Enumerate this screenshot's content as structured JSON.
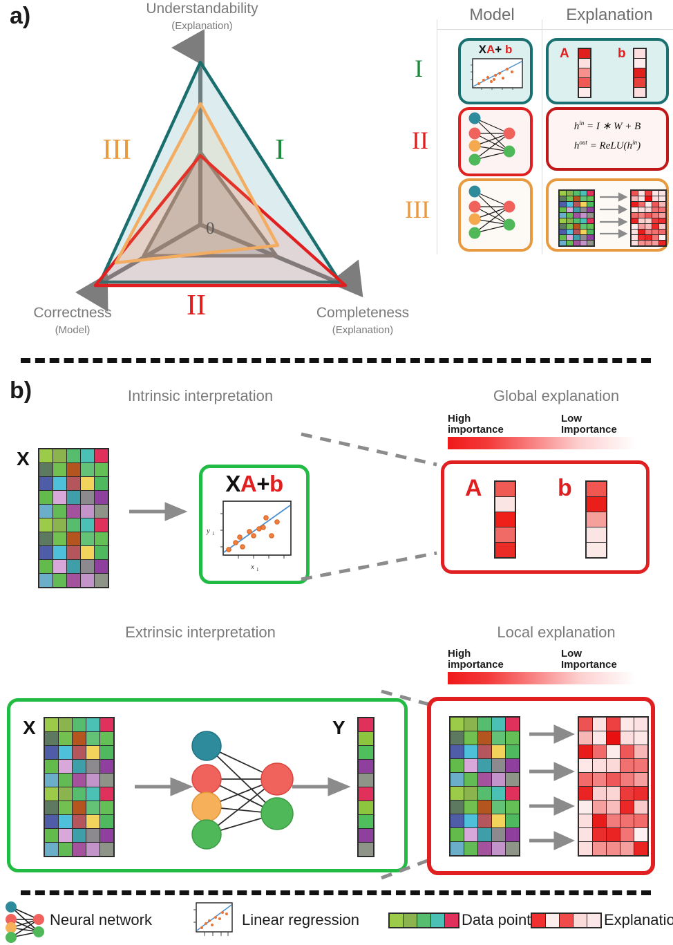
{
  "panels": {
    "a_label": "a)",
    "b_label": "b)"
  },
  "radar": {
    "axes": [
      {
        "name": "Understandability",
        "sub": "(Explanation)"
      },
      {
        "name": "Correctness",
        "sub": "(Model)"
      },
      {
        "name": "Completeness",
        "sub": "(Explanation)"
      }
    ],
    "origin_label": "0",
    "series": [
      {
        "label": "I",
        "color": "#1a6e6e",
        "fill": "#1a6e6e",
        "values": {
          "understandability": 1.0,
          "correctness": 0.97,
          "completeness": 1.0
        }
      },
      {
        "label": "II",
        "color": "#e02020",
        "fill": "#e02020",
        "values": {
          "understandability": 0.55,
          "correctness": 1.0,
          "completeness": 1.0
        }
      },
      {
        "label": "III",
        "color": "#f0a050",
        "fill": "#f0a050",
        "values": {
          "understandability": 0.84,
          "correctness": 0.86,
          "completeness": 0.66
        }
      }
    ],
    "inner_triangle_color": "#8a8179",
    "axis_color": "#7d7d7d"
  },
  "table": {
    "columns": [
      "Model",
      "Explanation"
    ],
    "rows": [
      {
        "roman": "I",
        "color": "#1a7070",
        "model_kind": "linear-regression-plot",
        "model_formula": {
          "x": "X",
          "a": "A",
          "plus": "+",
          "b": "b"
        },
        "explanation_kind": "weight-vectors",
        "vectors": [
          {
            "label": "A",
            "cells": [
              "#e0201c",
              "#fbe0df",
              "#f5908c",
              "#ef5a55",
              "#fdeceb"
            ]
          },
          {
            "label": "b",
            "cells": [
              "#fbdedd",
              "#fdeceb",
              "#e0201c",
              "#e8413c",
              "#fbdedd"
            ]
          }
        ]
      },
      {
        "roman": "II",
        "color": "#e02020",
        "model_kind": "neural-network",
        "explanation_kind": "formula",
        "formula_lines": [
          "h^{in} = I * W + B",
          "h^{out} = ReLU(h^{in})"
        ]
      },
      {
        "roman": "III",
        "color": "#e89a40",
        "model_kind": "neural-network",
        "explanation_kind": "heatmap-transform"
      }
    ]
  },
  "sections": [
    {
      "left_title": "Intrinsic interpretation",
      "right_title": "Global explanation",
      "scale": {
        "high": "High",
        "high2": "importance",
        "low": "Low",
        "low2": "Importance"
      },
      "input_label": "X",
      "model_formula": {
        "x": "X",
        "a": "A",
        "plus": "+",
        "b": "b"
      },
      "explain_vectors": [
        {
          "label": "A",
          "cells": [
            "#ef5a55",
            "#fbe5e4",
            "#ef1f1a",
            "#f06b66",
            "#ea2b26"
          ]
        },
        {
          "label": "b",
          "cells": [
            "#f25651",
            "#ea1f1a",
            "#f6a09c",
            "#fbe5e4",
            "#fbe9e8"
          ]
        }
      ]
    },
    {
      "left_title": "Extrinsic interpretation",
      "right_title": "Local explanation",
      "scale": {
        "high": "High",
        "high2": "importance",
        "low": "Low",
        "low2": "Importance"
      },
      "input_label": "X",
      "output_label": "Y"
    }
  ],
  "legend": [
    {
      "icon": "neural-network-icon",
      "label": "Neural network"
    },
    {
      "icon": "linear-regression-icon",
      "label": "Linear regression"
    },
    {
      "icon": "data-point-swatch-icon",
      "label": "Data point",
      "swatch": [
        "#9ccb49",
        "#8bb44f",
        "#56bd6e",
        "#4bc0b4",
        "#e0315c"
      ]
    },
    {
      "icon": "explanation-swatch-icon",
      "label": "Explanation",
      "swatch": [
        "#f03030",
        "#fdeeee",
        "#f04a4a",
        "#fbdada",
        "#fbe7e7"
      ]
    }
  ],
  "colors": {
    "green_box": "#22bb44",
    "red_box": "#e02020",
    "teal": "#1a7070",
    "orange": "#e89a40",
    "arrow_gray": "#808080",
    "data_palette": [
      "#9ccb49",
      "#8bb44f",
      "#56bd6e",
      "#4bc0b4",
      "#e0315c",
      "#5d7a61",
      "#72c04f",
      "#b4541f",
      "#63c276",
      "#64c056",
      "#4f5ca8",
      "#4fc0da",
      "#b4565c",
      "#f2d45c",
      "#4fb95f",
      "#63bb4c",
      "#d9a8da",
      "#3f9fa8",
      "#8d8a8f",
      "#8f3f9e",
      "#6aaec9",
      "#62bb54",
      "#a4529e",
      "#c294c9",
      "#8f9489"
    ]
  },
  "legend_scatter": {
    "xlabel": "x₁",
    "ylabel": "y₁"
  }
}
